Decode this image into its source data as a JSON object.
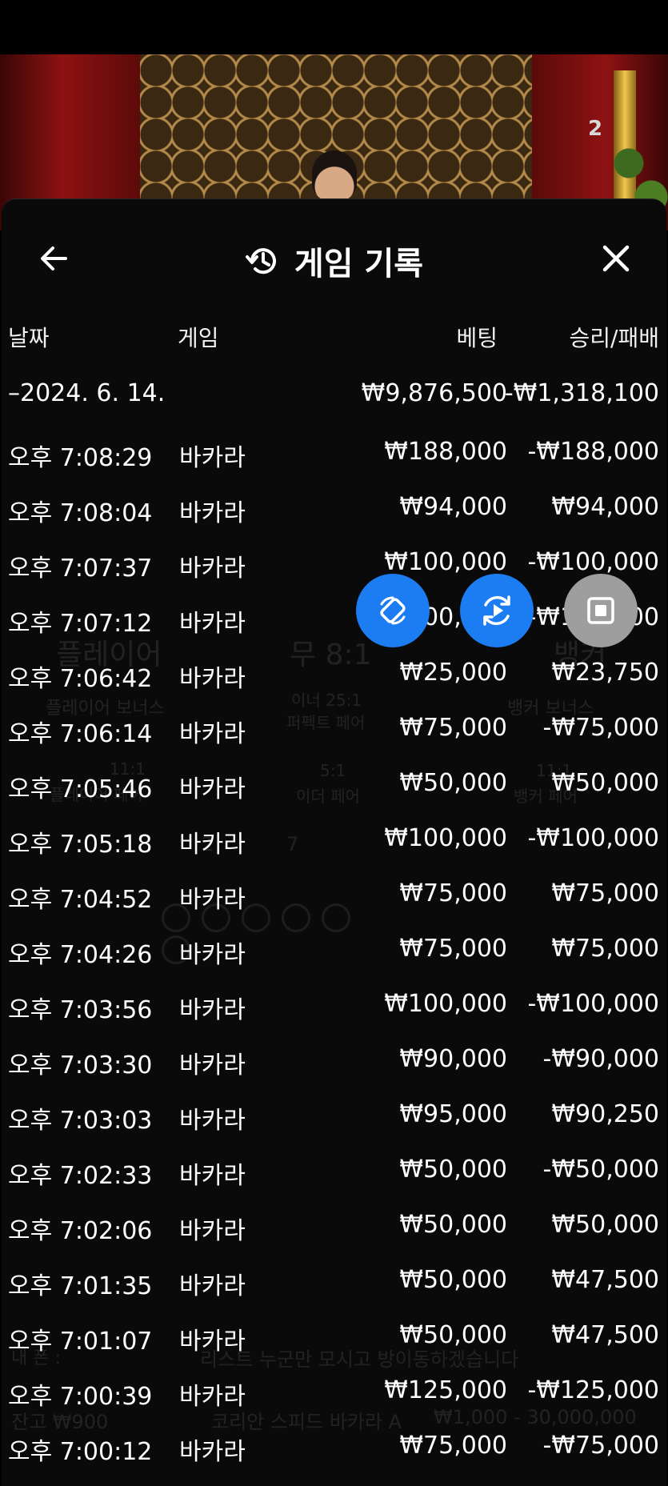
{
  "live": {
    "overlay_number": "2"
  },
  "header": {
    "title": "게임 기록"
  },
  "columns": {
    "date": "날짜",
    "game": "게임",
    "bet": "베팅",
    "result": "승리/패배"
  },
  "summary": {
    "date": "–2024. 6. 14.",
    "bet": "₩9,876,500",
    "result": "-₩1,318,100"
  },
  "rows": [
    {
      "time": "오후 7:08:29",
      "game": "바카라",
      "bet": "₩188,000",
      "result": "-₩188,000"
    },
    {
      "time": "오후 7:08:04",
      "game": "바카라",
      "bet": "₩94,000",
      "result": "₩94,000"
    },
    {
      "time": "오후 7:07:37",
      "game": "바카라",
      "bet": "₩100,000",
      "result": "-₩100,000"
    },
    {
      "time": "오후 7:07:12",
      "game": "바카라",
      "bet": "₩100,000",
      "result": "-₩100,000"
    },
    {
      "time": "오후 7:06:42",
      "game": "바카라",
      "bet": "₩25,000",
      "result": "₩23,750"
    },
    {
      "time": "오후 7:06:14",
      "game": "바카라",
      "bet": "₩75,000",
      "result": "-₩75,000"
    },
    {
      "time": "오후 7:05:46",
      "game": "바카라",
      "bet": "₩50,000",
      "result": "₩50,000"
    },
    {
      "time": "오후 7:05:18",
      "game": "바카라",
      "bet": "₩100,000",
      "result": "-₩100,000"
    },
    {
      "time": "오후 7:04:52",
      "game": "바카라",
      "bet": "₩75,000",
      "result": "₩75,000"
    },
    {
      "time": "오후 7:04:26",
      "game": "바카라",
      "bet": "₩75,000",
      "result": "₩75,000"
    },
    {
      "time": "오후 7:03:56",
      "game": "바카라",
      "bet": "₩100,000",
      "result": "-₩100,000"
    },
    {
      "time": "오후 7:03:30",
      "game": "바카라",
      "bet": "₩90,000",
      "result": "-₩90,000"
    },
    {
      "time": "오후 7:03:03",
      "game": "바카라",
      "bet": "₩95,000",
      "result": "₩90,250"
    },
    {
      "time": "오후 7:02:33",
      "game": "바카라",
      "bet": "₩50,000",
      "result": "-₩50,000"
    },
    {
      "time": "오후 7:02:06",
      "game": "바카라",
      "bet": "₩50,000",
      "result": "₩50,000"
    },
    {
      "time": "오후 7:01:35",
      "game": "바카라",
      "bet": "₩50,000",
      "result": "₩47,500"
    },
    {
      "time": "오후 7:01:07",
      "game": "바카라",
      "bet": "₩50,000",
      "result": "₩47,500"
    },
    {
      "time": "오후 7:00:39",
      "game": "바카라",
      "bet": "₩125,000",
      "result": "-₩125,000"
    },
    {
      "time": "오후 7:00:12",
      "game": "바카라",
      "bet": "₩75,000",
      "result": "-₩75,000"
    }
  ],
  "background_ghost": {
    "player": "플레이어",
    "tie": "무 8:1",
    "banker": "뱅커",
    "player_bonus": "플레이어 보너스",
    "either_pair": "이너 25:1",
    "perfect_pair": "퍼펙트 페어",
    "banker_bonus": "뱅커 보너스",
    "player_pair_odds": "11:1",
    "player_pair": "플레이어 페어",
    "either_pair_odds": "5:1",
    "either_pair_label": "이더 페어",
    "banker_pair_odds": "11:1",
    "banker_pair": "뱅커 페어",
    "count_2": "2",
    "count_7": "7",
    "chat_line": "리스트 누군만 모시고 방이동하겠습니다",
    "chat_user": "내 폰 :",
    "balance": "잔고 ₩900",
    "table_name": "코리안 스피드 바카라 A",
    "table_limits": "₩1,000 - 30,000,000"
  },
  "controls": {
    "rotate_icon": "rotate-icon",
    "replay_icon": "replay-icon",
    "stop_icon": "stop-icon"
  },
  "colors": {
    "fab_blue": "#1c7cf2",
    "fab_gray": "#9e9e9e",
    "sheet_bg": "#0a0a0a"
  }
}
